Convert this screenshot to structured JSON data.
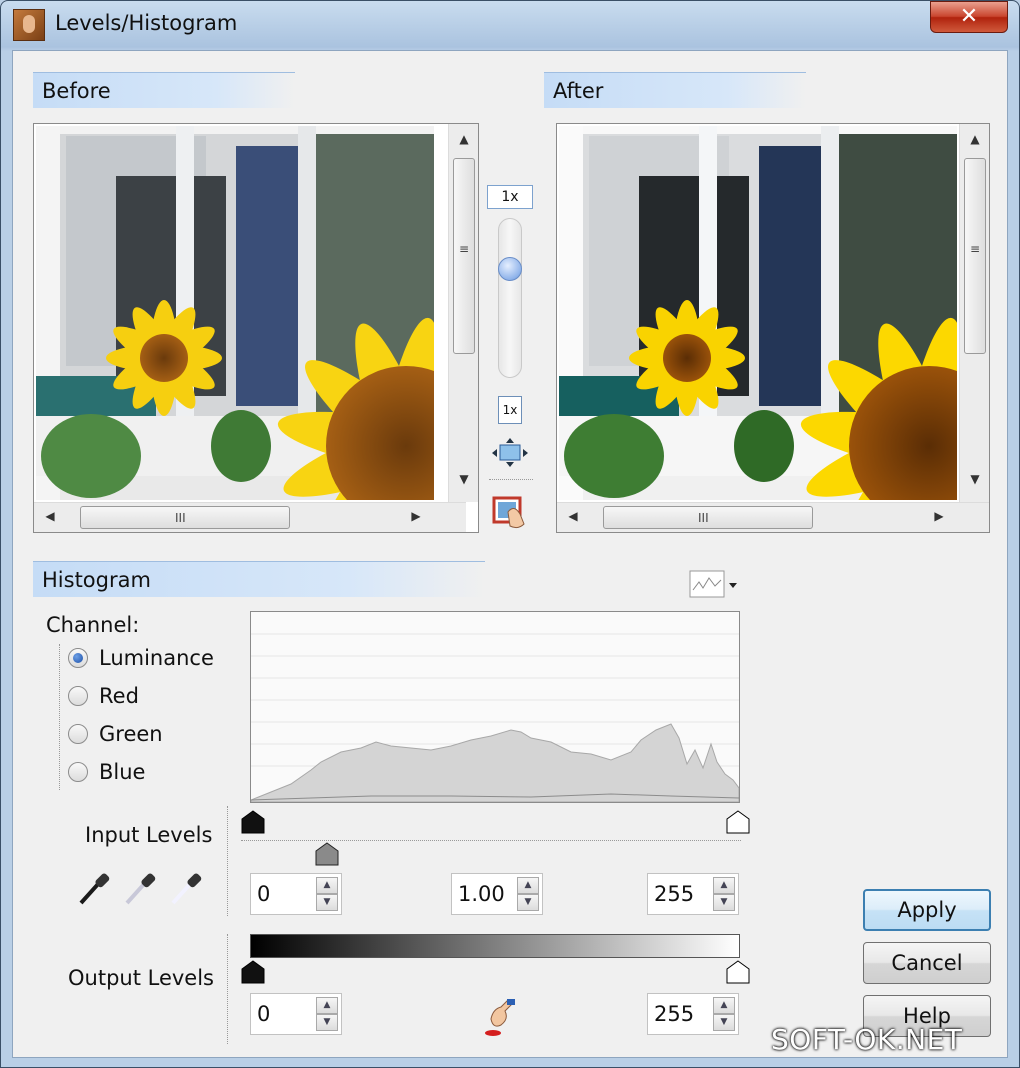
{
  "window": {
    "title": "Levels/Histogram",
    "close_glyph": "✕"
  },
  "preview": {
    "before_label": "Before",
    "after_label": "After",
    "zoom_level": "1x",
    "actual_size_label": "1x",
    "scrollbar_grip": "III"
  },
  "histogram": {
    "title": "Histogram",
    "channel_label": "Channel:",
    "channels": [
      "Luminance",
      "Red",
      "Green",
      "Blue"
    ],
    "selected_channel": "Luminance"
  },
  "input_levels": {
    "label": "Input Levels",
    "black": "0",
    "gamma": "1.00",
    "white": "255"
  },
  "output_levels": {
    "label": "Output Levels",
    "black": "0",
    "white": "255"
  },
  "buttons": {
    "apply": "Apply",
    "cancel": "Cancel",
    "help": "Help"
  },
  "watermark": "SOFT-OK.NET",
  "colors": {
    "header_gradient": "#c5dcf6",
    "default_button_border": "#3c7fb1",
    "close_button": "#c9452e"
  }
}
